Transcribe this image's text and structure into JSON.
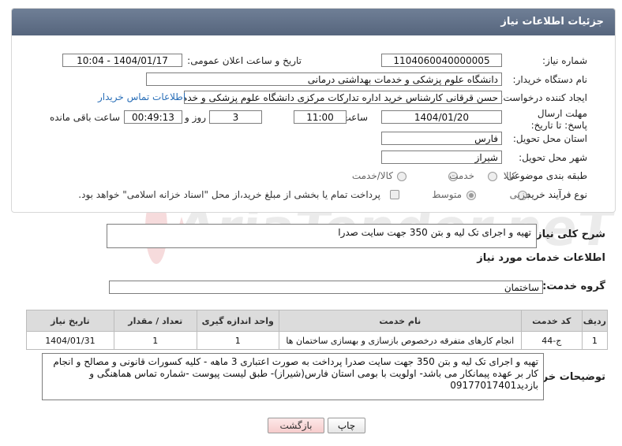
{
  "panel": {
    "title": "جزئیات اطلاعات نیاز"
  },
  "labels": {
    "need_number": "شماره نیاز:",
    "announce_datetime": "تاریخ و ساعت اعلان عمومی:",
    "buyer_org": "نام دستگاه خریدار:",
    "requester": "ایجاد کننده درخواست:",
    "deadline": "مهلت ارسال پاسخ: تا تاریخ:",
    "time": "ساعت",
    "days_and": "روز و",
    "hours_left": "ساعت باقی مانده",
    "province": "استان محل تحویل:",
    "city": "شهر محل تحویل:",
    "category": "طبقه بندی موضوعی:",
    "process_type": "نوع فرآیند خرید :",
    "description": "شرح کلی نیاز:",
    "services_info": "اطلاعات خدمات مورد نیاز",
    "service_group": "گروه خدمت:",
    "buyer_notes": "توضیحات خریدار:"
  },
  "values": {
    "need_number": "1104060040000005",
    "announce_datetime": "1404/01/17 - 10:04",
    "buyer_org": "دانشگاه علوم پزشکی و خدمات بهداشتی درمانی",
    "requester": "حسن قرقانی کارشناس خرید اداره تدارکات مرکزی دانشگاه علوم پزشکی و خدم",
    "deadline_date": "1404/01/20",
    "deadline_time": "11:00",
    "days": "3",
    "remaining": "00:49:13",
    "province": "فارس",
    "city": "شیراز",
    "description": "تهیه و اجرای تک لیه و بتن 350 جهت سایت صدرا",
    "service_group": "ساختمان",
    "buyer_notes": "تهیه و اجرای تک لیه و بتن 350 جهت سایت صدرا پرداخت به صورت اعتباری 3 ماهه - کلیه کسورات قانونی و مصالح و انجام کار  بر عهده پیمانکار می باشد- اولویت با بومی استان فارس(شیراز)- طبق لیست پیوست -شماره تماس هماهنگی و بازدید09177017401"
  },
  "links": {
    "buyer_contact": "اطلاعات تماس خریدار"
  },
  "category_options": {
    "goods": "کالا",
    "service": "خدمت",
    "goods_service": "کالا/خدمت"
  },
  "process_options": {
    "partial": "جزیی",
    "medium": "متوسط",
    "treasury_note": "پرداخت تمام یا بخشی از مبلغ خرید،از محل \"اسناد خزانه اسلامی\" خواهد بود."
  },
  "table": {
    "headers": [
      "ردیف",
      "کد خدمت",
      "نام خدمت",
      "واحد اندازه گیری",
      "تعداد / مقدار",
      "تاریخ نیاز"
    ],
    "rows": [
      [
        "1",
        "ج-44",
        "انجام کارهای متفرقه درخصوص بازسازی و بهسازی ساختمان ها",
        "1",
        "1",
        "1404/01/31"
      ]
    ]
  },
  "buttons": {
    "print": "چاپ",
    "back": "بازگشت"
  },
  "watermark": {
    "text": "AriaTender.neT"
  },
  "colors": {
    "header_bg": "#5f6f88",
    "link": "#2a6fb8",
    "back_button": "#f6cccc"
  }
}
